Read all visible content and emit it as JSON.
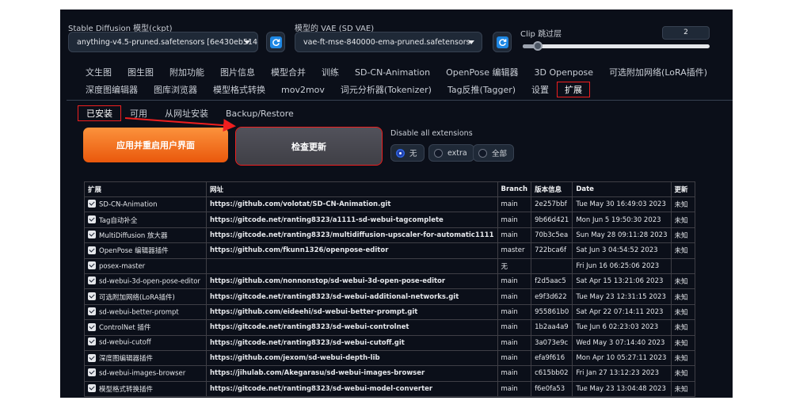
{
  "top": {
    "ckpt_label": "Stable Diffusion 模型(ckpt)",
    "ckpt_value": "anything-v4.5-pruned.safetensors [6e430eb514]",
    "vae_label": "模型的 VAE (SD VAE)",
    "vae_value": "vae-ft-mse-840000-ema-pruned.safetensors",
    "clip_label": "Clip 跳过层",
    "clip_value": "2",
    "clip_fraction": 0.08
  },
  "tabs_row1": [
    "文生图",
    "图生图",
    "附加功能",
    "图片信息",
    "模型合并",
    "训练",
    "SD-CN-Animation",
    "OpenPose 编辑器",
    "3D Openpose",
    "可选附加网络(LoRA插件)"
  ],
  "tabs_row2": [
    "深度图编辑器",
    "图库浏览器",
    "模型格式转换",
    "mov2mov",
    "词元分析器(Tokenizer)",
    "Tag反推(Tagger)",
    "设置",
    "扩展"
  ],
  "active_tab": "扩展",
  "subtabs": [
    "已安装",
    "可用",
    "从网址安装",
    "Backup/Restore"
  ],
  "actions": {
    "apply_label": "应用并重启用户界面",
    "check_label": "检查更新",
    "disable_label": "Disable all extensions",
    "options": [
      "无",
      "extra",
      "全部"
    ],
    "selected": "无"
  },
  "table": {
    "headers": [
      "扩展",
      "网址",
      "Branch",
      "版本信息",
      "Date",
      "更新"
    ],
    "rows": [
      {
        "name": "SD-CN-Animation",
        "url": "https://github.com/volotat/SD-CN-Animation.git",
        "branch": "main",
        "version": "2e257bbf",
        "date": "Tue May 30 16:49:03 2023",
        "update": "未知"
      },
      {
        "name": "Tag自动补全",
        "url": "https://gitcode.net/ranting8323/a1111-sd-webui-tagcomplete",
        "branch": "main",
        "version": "9b66d421",
        "date": "Mon Jun 5 19:50:30 2023",
        "update": "未知"
      },
      {
        "name": "MultiDiffusion 放大器",
        "url": "https://gitcode.net/ranting8323/multidiffusion-upscaler-for-automatic1111",
        "branch": "main",
        "version": "70b3c5ea",
        "date": "Sun May 28 09:11:28 2023",
        "update": "未知"
      },
      {
        "name": "OpenPose 编辑器插件",
        "url": "https://github.com/fkunn1326/openpose-editor",
        "branch": "master",
        "version": "722bca6f",
        "date": "Sat Jun 3 04:54:52 2023",
        "update": "未知"
      },
      {
        "name": "posex-master",
        "url": "",
        "branch": "无",
        "version": "",
        "date": "Fri Jun 16 06:25:06 2023",
        "update": ""
      },
      {
        "name": "sd-webui-3d-open-pose-editor",
        "url": "https://github.com/nonnonstop/sd-webui-3d-open-pose-editor",
        "branch": "main",
        "version": "f2d5aac5",
        "date": "Sat Apr 15 13:21:06 2023",
        "update": "未知"
      },
      {
        "name": "可选附加网络(LoRA插件)",
        "url": "https://gitcode.net/ranting8323/sd-webui-additional-networks.git",
        "branch": "main",
        "version": "e9f3d622",
        "date": "Tue May 23 12:31:15 2023",
        "update": "未知"
      },
      {
        "name": "sd-webui-better-prompt",
        "url": "https://github.com/eideehi/sd-webui-better-prompt.git",
        "branch": "main",
        "version": "955861b0",
        "date": "Sat Apr 22 07:14:11 2023",
        "update": "未知"
      },
      {
        "name": "ControlNet 插件",
        "url": "https://gitcode.net/ranting8323/sd-webui-controlnet",
        "branch": "main",
        "version": "1b2aa4a9",
        "date": "Tue Jun 6 02:23:03 2023",
        "update": "未知"
      },
      {
        "name": "sd-webui-cutoff",
        "url": "https://gitcode.net/ranting8323/sd-webui-cutoff.git",
        "branch": "main",
        "version": "3a073e9c",
        "date": "Wed May 3 07:14:40 2023",
        "update": "未知"
      },
      {
        "name": "深度图编辑器插件",
        "url": "https://github.com/jexom/sd-webui-depth-lib",
        "branch": "main",
        "version": "efa9f616",
        "date": "Mon Apr 10 05:27:11 2023",
        "update": "未知"
      },
      {
        "name": "sd-webui-images-browser",
        "url": "https://jihulab.com/Akegarasu/sd-webui-images-browser",
        "branch": "main",
        "version": "c615bb02",
        "date": "Fri Jan 27 13:12:23 2023",
        "update": "未知"
      },
      {
        "name": "模型格式转换插件",
        "url": "https://gitcode.net/ranting8323/sd-webui-model-converter",
        "branch": "main",
        "version": "f6e0fa53",
        "date": "Tue May 23 13:04:48 2023",
        "update": "未知"
      }
    ]
  }
}
